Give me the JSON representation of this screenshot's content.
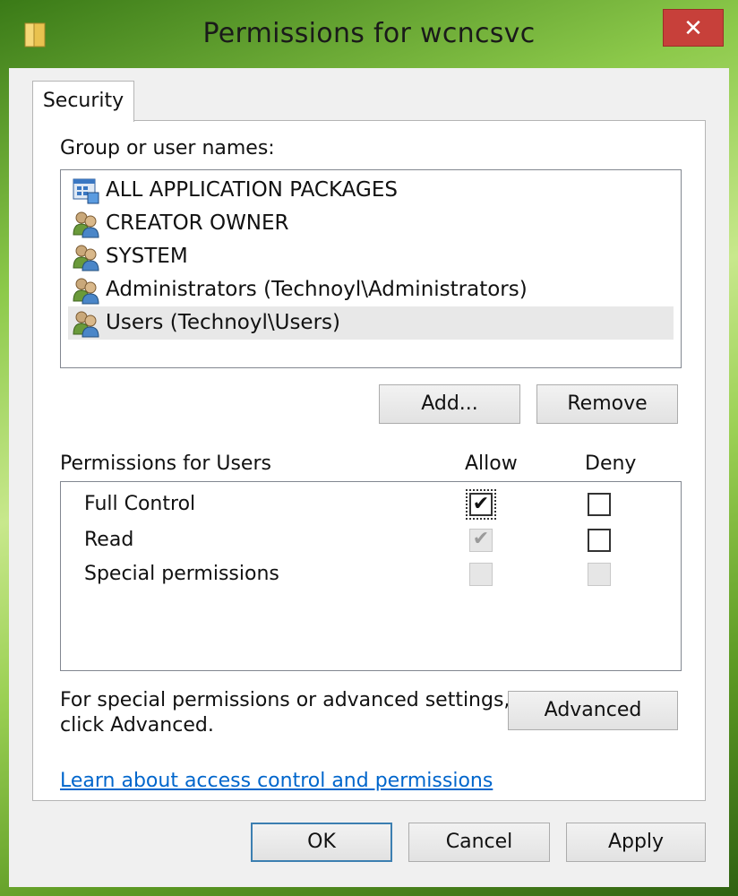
{
  "window": {
    "title": "Permissions for wcncsvc",
    "close_label": "✕"
  },
  "tabs": [
    {
      "label": "Security",
      "active": true
    }
  ],
  "group_section": {
    "label": "Group or user names:",
    "items": [
      {
        "label": "ALL APPLICATION PACKAGES",
        "icon": "app-packages-icon",
        "selected": false
      },
      {
        "label": "CREATOR OWNER",
        "icon": "users-group-icon",
        "selected": false
      },
      {
        "label": "SYSTEM",
        "icon": "users-group-icon",
        "selected": false
      },
      {
        "label": "Administrators (Technoyl\\Administrators)",
        "icon": "users-group-icon",
        "selected": false
      },
      {
        "label": "Users (Technoyl\\Users)",
        "icon": "users-group-icon",
        "selected": true
      }
    ],
    "add_label": "Add...",
    "remove_label": "Remove"
  },
  "permissions": {
    "header_label": "Permissions for Users",
    "allow_label": "Allow",
    "deny_label": "Deny",
    "rows": [
      {
        "label": "Full Control",
        "allow": "checked",
        "deny": "unchecked"
      },
      {
        "label": "Read",
        "allow": "checked-disabled",
        "deny": "unchecked"
      },
      {
        "label": "Special permissions",
        "allow": "disabled",
        "deny": "disabled"
      }
    ]
  },
  "advanced": {
    "text_line1": "For special permissions or advanced settings,",
    "text_line2": "click Advanced.",
    "button_label": "Advanced"
  },
  "help_link": "Learn about access control and permissions",
  "footer": {
    "ok_label": "OK",
    "cancel_label": "Cancel",
    "apply_label": "Apply"
  },
  "colors": {
    "close_button": "#c7403a",
    "link": "#0066cc",
    "default_button_border": "#3c7fb1"
  }
}
